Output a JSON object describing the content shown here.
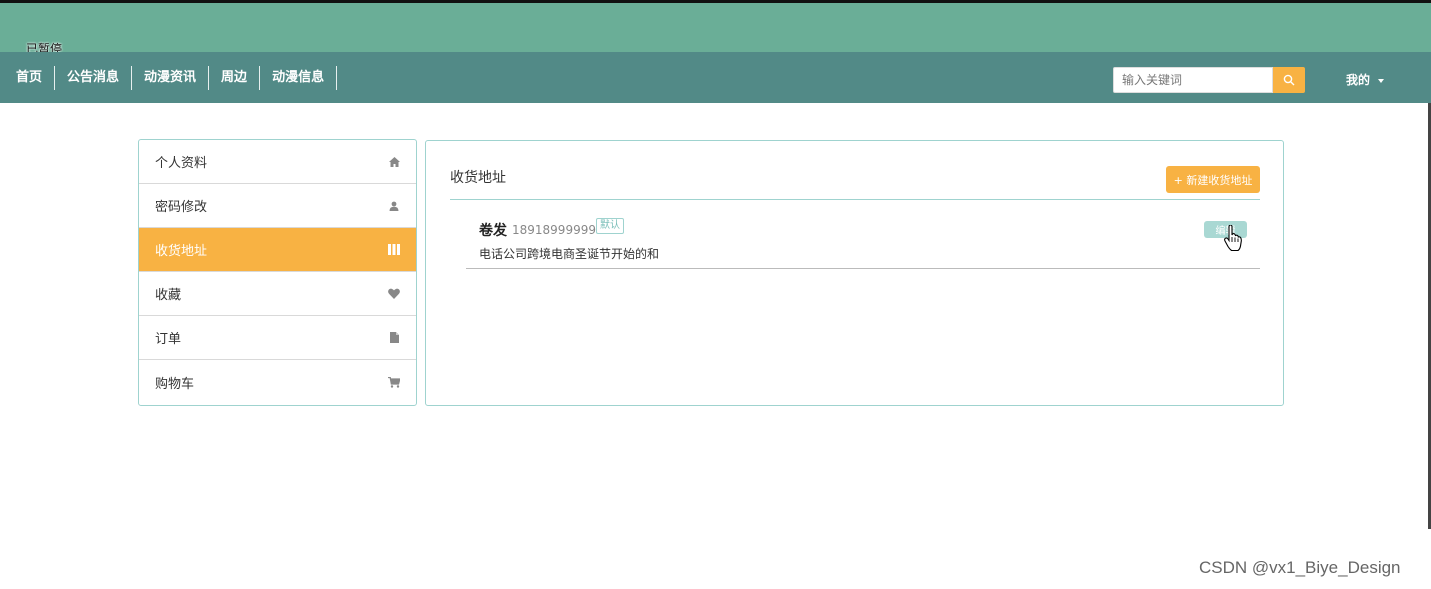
{
  "overlay": {
    "paused_label": "已暂停"
  },
  "nav": {
    "items": [
      "首页",
      "公告消息",
      "动漫资讯",
      "周边",
      "动漫信息"
    ],
    "search_placeholder": "输入关键词",
    "user_menu": "我的"
  },
  "sidebar": {
    "items": [
      {
        "label": "个人资料",
        "icon": "home-icon"
      },
      {
        "label": "密码修改",
        "icon": "user-icon"
      },
      {
        "label": "收货地址",
        "icon": "columns-icon",
        "active": true
      },
      {
        "label": "收藏",
        "icon": "heart-icon"
      },
      {
        "label": "订单",
        "icon": "file-icon"
      },
      {
        "label": "购物车",
        "icon": "cart-icon"
      }
    ]
  },
  "main": {
    "title": "收货地址",
    "new_button": "+ 新建收货地址",
    "address": {
      "name": "卷发",
      "phone": "18918999999",
      "badge": "默认",
      "detail": "电话公司跨境电商圣诞节开始的和",
      "edit_label": "编辑"
    }
  },
  "colors": {
    "accent": "#f8b243",
    "header": "#6aae97",
    "navbar": "#528a87",
    "border": "#9fd3cf"
  },
  "watermark": "CSDN @vx1_Biye_Design"
}
